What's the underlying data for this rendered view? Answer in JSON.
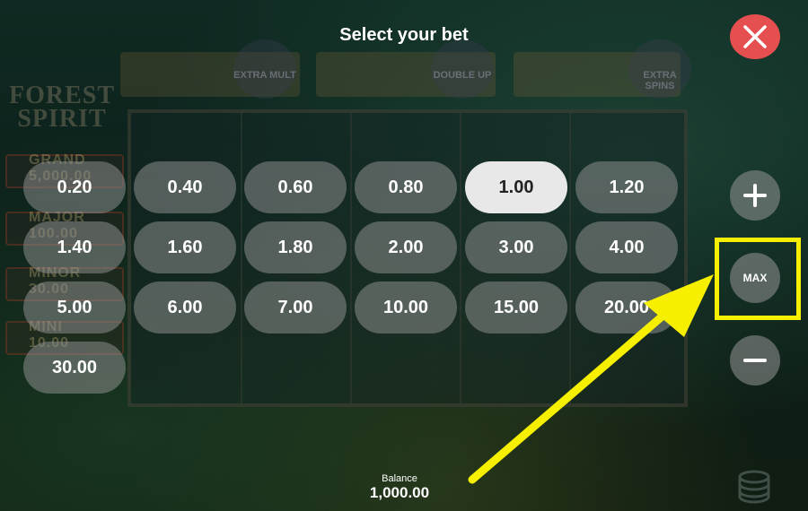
{
  "title": "Select your bet",
  "game": {
    "logo_line1": "FOREST",
    "logo_line2": "SPIRIT",
    "jackpots": [
      {
        "label": "GRAND",
        "value": "5,000.00"
      },
      {
        "label": "MAJOR",
        "value": "100.00"
      },
      {
        "label": "MINOR",
        "value": "30.00"
      },
      {
        "label": "MINI",
        "value": "10.00"
      }
    ],
    "features": [
      "EXTRA MULT",
      "DOUBLE UP",
      "EXTRA SPINS"
    ]
  },
  "bets": {
    "options": [
      "0.20",
      "0.40",
      "0.60",
      "0.80",
      "1.00",
      "1.20",
      "1.40",
      "1.60",
      "1.80",
      "2.00",
      "3.00",
      "4.00",
      "5.00",
      "6.00",
      "7.00",
      "10.00",
      "15.00",
      "20.00",
      "30.00"
    ],
    "selected": "1.00"
  },
  "controls": {
    "max_label": "MAX",
    "plus_icon": "plus-icon",
    "minus_icon": "minus-icon",
    "close_icon": "close-icon",
    "coins_icon": "coins-icon"
  },
  "balance": {
    "label": "Balance",
    "value": "1,000.00"
  },
  "colors": {
    "close_button": "#e54f4f",
    "chip": "rgba(150,150,150,0.5)",
    "chip_selected": "#e8e8e8",
    "highlight": "#f6f000"
  }
}
